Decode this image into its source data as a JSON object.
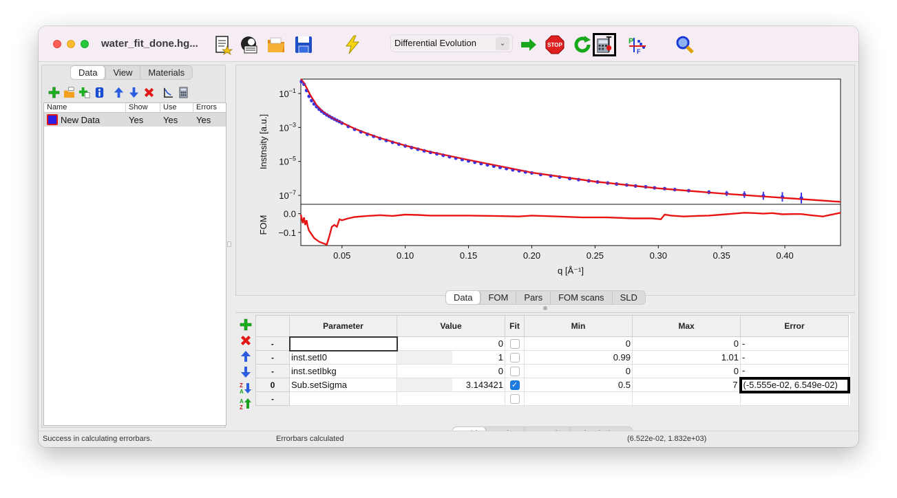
{
  "window": {
    "title": "water_fit_done.hg..."
  },
  "toolbar": {
    "algorithm": "Differential Evolution",
    "icons": [
      "new-file-icon",
      "new-model-icon",
      "open-file-icon",
      "save-icon",
      "lightning-icon",
      "start-fit-icon",
      "stop-icon",
      "restart-icon",
      "calculate-errorbars-icon",
      "project-fom-icon",
      "zoom-icon"
    ]
  },
  "left_tabs": [
    "Data",
    "View",
    "Materials"
  ],
  "data_list": {
    "columns": [
      "Name",
      "Show",
      "Use",
      "Errors"
    ],
    "rows": [
      {
        "name": "New Data",
        "show": "Yes",
        "use": "Yes",
        "errors": "Yes",
        "color": "#2b1fe6"
      }
    ]
  },
  "plot_tabs": [
    "Data",
    "FOM",
    "Pars",
    "FOM scans",
    "SLD"
  ],
  "chart_data": [
    {
      "type": "line",
      "ylabel": "Instnsity [a.u.]",
      "yscale": "log",
      "ylim": [
        3e-08,
        0.7
      ],
      "xlim": [
        0.0175,
        0.444
      ],
      "ytick_labels": [
        "10^-1",
        "10^-3",
        "10^-5",
        "10^-7"
      ],
      "series": [
        {
          "kind": "data_points",
          "color": "#3a33e6",
          "x": [
            0.018,
            0.02,
            0.022,
            0.024,
            0.026,
            0.028,
            0.03,
            0.032,
            0.034,
            0.036,
            0.038,
            0.04,
            0.042,
            0.044,
            0.046,
            0.048,
            0.05,
            0.055,
            0.06,
            0.065,
            0.07,
            0.075,
            0.08,
            0.085,
            0.09,
            0.095,
            0.1,
            0.105,
            0.11,
            0.115,
            0.12,
            0.125,
            0.13,
            0.135,
            0.14,
            0.145,
            0.15,
            0.155,
            0.16,
            0.165,
            0.17,
            0.175,
            0.18,
            0.185,
            0.19,
            0.195,
            0.2,
            0.207,
            0.215,
            0.222,
            0.23,
            0.237,
            0.245,
            0.252,
            0.26,
            0.267,
            0.275,
            0.282,
            0.29,
            0.297,
            0.305,
            0.313,
            0.324,
            0.34,
            0.354,
            0.368,
            0.383,
            0.398,
            0.413
          ],
          "y": [
            0.5,
            0.35,
            0.15,
            0.068,
            0.038,
            0.024,
            0.0165,
            0.0118,
            0.0089,
            0.0069,
            0.0055,
            0.0045,
            0.0037,
            0.0031,
            0.0026,
            0.0022,
            0.0018,
            0.00115,
            0.00078,
            0.00055,
            0.0004,
            0.0003,
            0.000225,
            0.000172,
            0.000133,
            0.000104,
            8.2e-05,
            6.5e-05,
            5.2e-05,
            4.2e-05,
            3.4e-05,
            2.8e-05,
            2.3e-05,
            1.89e-05,
            1.56e-05,
            1.29e-05,
            1.07e-05,
            8.9e-06,
            7.5e-06,
            6.3e-06,
            5.3e-06,
            4.5e-06,
            3.8e-06,
            3.2e-06,
            2.8e-06,
            2.4e-06,
            2.1e-06,
            1.7e-06,
            1.4e-06,
            1.2e-06,
            9.9e-07,
            8.5e-07,
            7.2e-07,
            6.2e-07,
            5.4e-07,
            4.7e-07,
            4.1e-07,
            3.6e-07,
            3.2e-07,
            2.8e-07,
            2.5e-07,
            2.2e-07,
            1.9e-07,
            1.55e-07,
            1.3e-07,
            1.12e-07,
            9.5e-08,
            8.2e-08,
            7e-08
          ]
        },
        {
          "kind": "fit",
          "color": "#e81414",
          "x": [
            0.0175,
            0.02,
            0.025,
            0.03,
            0.035,
            0.04,
            0.045,
            0.05,
            0.06,
            0.07,
            0.08,
            0.1,
            0.12,
            0.15,
            0.2,
            0.25,
            0.3,
            0.35,
            0.4,
            0.444
          ],
          "y": [
            0.7,
            0.42,
            0.08,
            0.02,
            0.0085,
            0.0047,
            0.0028,
            0.0019,
            0.00085,
            0.00043,
            0.00024,
            8.6e-05,
            3.6e-05,
            1.22e-05,
            2.2e-06,
            6.5e-07,
            2.6e-07,
            1.3e-07,
            7.1e-08,
            4.2e-08
          ]
        }
      ]
    },
    {
      "type": "line",
      "ylabel": "FOM",
      "xlabel": "q [Å⁻¹]",
      "xlim": [
        0.0175,
        0.444
      ],
      "ylim": [
        -0.17,
        0.05
      ],
      "ytick_labels": [
        "0.0",
        "-0.1"
      ],
      "xtick_labels": [
        "0.05",
        "0.10",
        "0.15",
        "0.20",
        "0.25",
        "0.30",
        "0.35",
        "0.40"
      ],
      "xticks": [
        0.05,
        0.1,
        0.15,
        0.2,
        0.25,
        0.3,
        0.35,
        0.4
      ],
      "series": [
        {
          "color": "#e81414",
          "x": [
            0.0175,
            0.019,
            0.02,
            0.021,
            0.022,
            0.023,
            0.024,
            0.025,
            0.026,
            0.028,
            0.03,
            0.032,
            0.034,
            0.036,
            0.038,
            0.04,
            0.042,
            0.044,
            0.046,
            0.048,
            0.05,
            0.055,
            0.06,
            0.065,
            0.07,
            0.075,
            0.08,
            0.09,
            0.1,
            0.11,
            0.12,
            0.13,
            0.15,
            0.17,
            0.19,
            0.2,
            0.22,
            0.24,
            0.26,
            0.28,
            0.295,
            0.302,
            0.305,
            0.308,
            0.31,
            0.32,
            0.33,
            0.34,
            0.35,
            0.36,
            0.368,
            0.376,
            0.383,
            0.39,
            0.398,
            0.406,
            0.413,
            0.42,
            0.43,
            0.444
          ],
          "y": [
            -0.005,
            -0.05,
            -0.02,
            -0.06,
            -0.035,
            -0.07,
            -0.09,
            -0.1,
            -0.11,
            -0.13,
            -0.14,
            -0.15,
            -0.155,
            -0.16,
            -0.165,
            -0.12,
            -0.07,
            -0.06,
            -0.07,
            -0.03,
            -0.035,
            -0.025,
            -0.018,
            -0.015,
            -0.012,
            -0.01,
            -0.008,
            -0.012,
            -0.005,
            -0.007,
            -0.01,
            -0.01,
            -0.01,
            -0.012,
            -0.015,
            -0.01,
            -0.015,
            -0.02,
            -0.02,
            -0.025,
            -0.025,
            -0.03,
            -0.005,
            -0.008,
            -0.01,
            -0.015,
            -0.012,
            -0.01,
            -0.005,
            0.0,
            0.005,
            0.003,
            0.0,
            0.003,
            -0.003,
            -0.002,
            -0.002,
            -0.008,
            -0.015,
            0.005
          ]
        }
      ]
    }
  ],
  "grid": {
    "columns": [
      "Parameter",
      "Value",
      "Fit",
      "Min",
      "Max",
      "Error"
    ],
    "rows": [
      {
        "hdr": "-",
        "param": "",
        "value": "0",
        "fit": false,
        "min": "0",
        "max": "0",
        "error": "-"
      },
      {
        "hdr": "-",
        "param": "inst.setI0",
        "value": "1",
        "fit": false,
        "min": "0.99",
        "max": "1.01",
        "error": "-"
      },
      {
        "hdr": "-",
        "param": "inst.setIbkg",
        "value": "0",
        "fit": false,
        "min": "0",
        "max": "0",
        "error": "-"
      },
      {
        "hdr": "0",
        "param": "Sub.setSigma",
        "value": "3.143421",
        "fit": true,
        "min": "0.5",
        "max": "7",
        "error": "(-5.555e-02, 6.549e-02)"
      },
      {
        "hdr": "-",
        "param": "",
        "value": "",
        "fit": false,
        "min": "",
        "max": "",
        "error": ""
      }
    ]
  },
  "grid_tabs": [
    "Grid",
    "Script",
    "Sample",
    "Simulations"
  ],
  "status": {
    "left": "Success in calculating errorbars.",
    "middle": "Errorbars calculated",
    "right": "(6.522e-02, 1.832e+03)"
  }
}
